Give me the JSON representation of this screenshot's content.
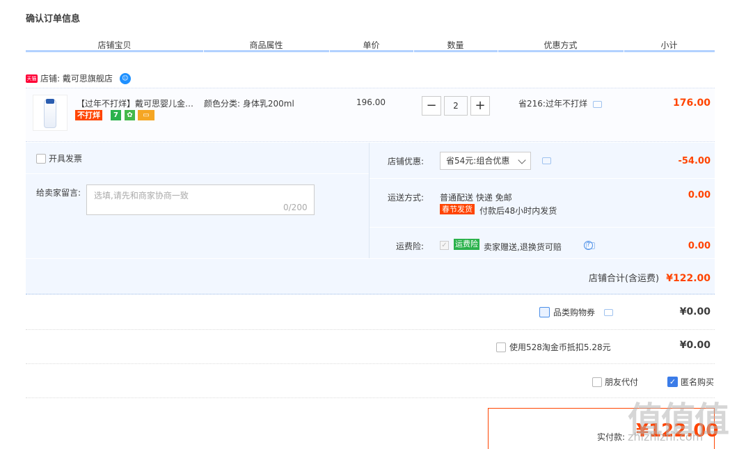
{
  "page_title": "确认订单信息",
  "columns": [
    "店铺宝贝",
    "商品属性",
    "单价",
    "数量",
    "优惠方式",
    "小计"
  ],
  "shop": {
    "badge": "天猫",
    "name": "店铺: 戴可思旗舰店"
  },
  "item": {
    "title": "【过年不打烊】戴可思婴儿金盏花身体乳",
    "tag": "不打烊",
    "prop": "颜色分类: 身体乳200ml",
    "price": "196.00",
    "qty": "2",
    "qty_minus": "−",
    "qty_plus": "+",
    "promo": "省216:过年不打烊",
    "subtotal": "176.00"
  },
  "invoice": {
    "label": "开具发票"
  },
  "message": {
    "label": "给卖家留言:",
    "placeholder": "选填,请先和商家协商一致",
    "count": "0/200"
  },
  "shop_discount": {
    "label": "店铺优惠:",
    "selected": "省54元:组合优惠",
    "amount": "-54.00"
  },
  "shipping": {
    "label": "运送方式:",
    "method": "普通配送 快递 免邮",
    "tag": "春节发货",
    "note": "付款后48小时内发货",
    "amount": "0.00"
  },
  "insurance": {
    "label": "运费险:",
    "tag": "运费险",
    "text": "卖家赠送,退换货可赔",
    "amount": "0.00"
  },
  "shop_total": {
    "label": "店铺合计(含运费)",
    "amount": "¥122.00"
  },
  "coupon": {
    "label": "品类购物券",
    "amount": "¥0.00"
  },
  "taojinbi": {
    "label": "使用528淘金币抵扣5.28元",
    "amount": "¥0.00"
  },
  "friend_pay": {
    "label": "朋友代付"
  },
  "anonymous": {
    "label": "匿名购买"
  },
  "pay": {
    "label": "实付款:",
    "amount": "¥122.00"
  },
  "watermark": {
    "text": "值值值",
    "site": "zhizhizhi.com"
  },
  "colors": {
    "accent": "#ff4400",
    "header_line": "#b2d1ff",
    "panel_bg": "#f2f7ff",
    "check_blue": "#3b7ce8"
  }
}
